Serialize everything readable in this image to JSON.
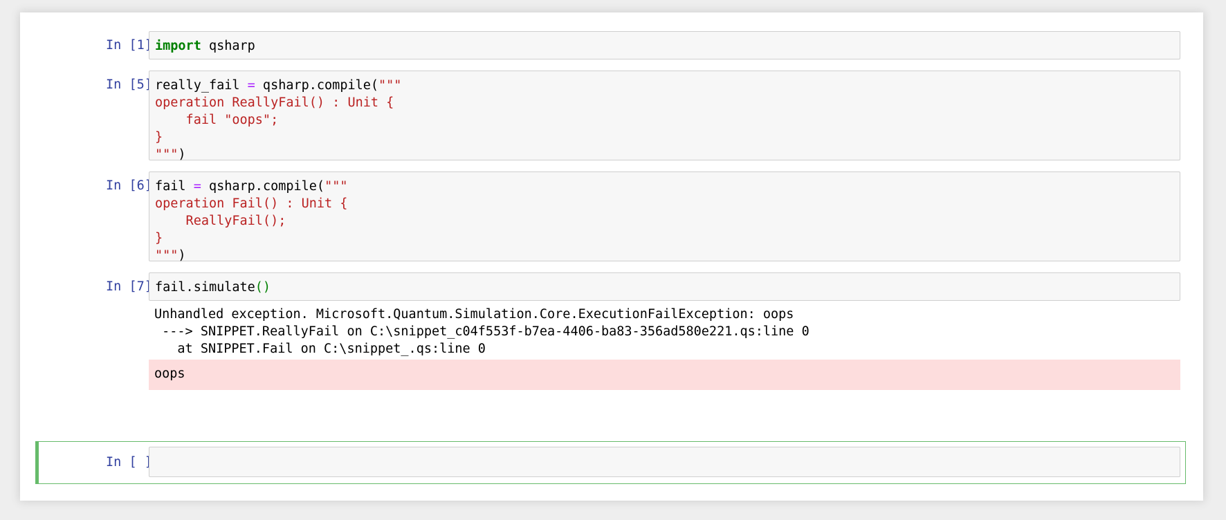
{
  "cells": [
    {
      "prompt": "In [1]:",
      "code_parts": [
        "import",
        " qsharp"
      ]
    },
    {
      "prompt": "In [5]:",
      "code_parts": [
        "really_fail ",
        "=",
        " qsharp.compile(",
        "\"\"\"\noperation ReallyFail() : Unit {\n    fail \"oops\";\n}\n\"\"\"",
        ")"
      ]
    },
    {
      "prompt": "In [6]:",
      "code_parts": [
        "fail ",
        "=",
        " qsharp.compile(",
        "\"\"\"\noperation Fail() : Unit {\n    ReallyFail();\n}\n\"\"\"",
        ")"
      ]
    },
    {
      "prompt": "In [7]:",
      "code_parts": [
        "fail.simulate",
        "()"
      ]
    },
    {
      "prompt": "In [ ]:",
      "code_parts": []
    }
  ],
  "output": {
    "exception_lines": [
      "Unhandled exception. Microsoft.Quantum.Simulation.Core.ExecutionFailException: oops",
      " ---> SNIPPET.ReallyFail on C:\\snippet_c04f553f-b7ea-4406-ba83-356ad580e221.qs:line 0",
      "   at SNIPPET.Fail on C:\\snippet_.qs:line 0"
    ],
    "stderr": "oops"
  },
  "colors": {
    "prompt": "#303f9f",
    "keyword": "#008000",
    "operator": "#aa22ff",
    "string": "#ba2121",
    "stderr_bg": "#fddddd",
    "selected_border": "#66bb6a"
  }
}
